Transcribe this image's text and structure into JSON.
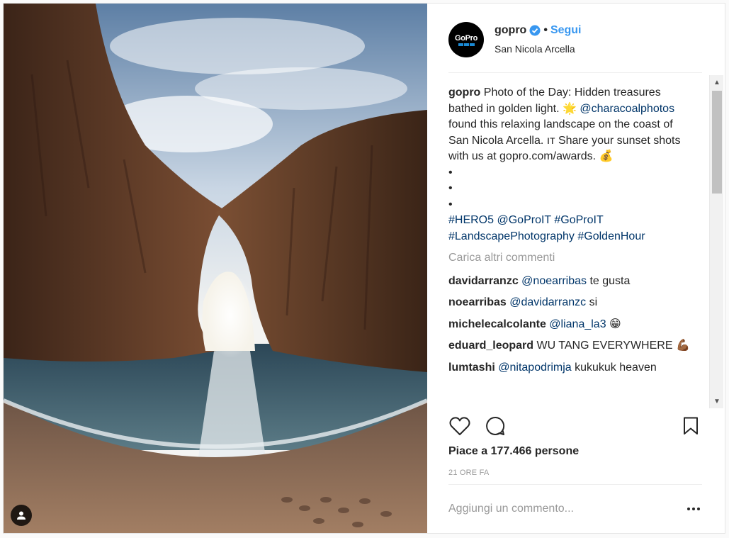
{
  "post": {
    "username": "gopro",
    "follow_label": "Segui",
    "separator": "•",
    "location": "San Nicola Arcella",
    "avatar_logo_text": "GoPro"
  },
  "caption": {
    "username": "gopro",
    "text_1": "Photo of the Day: Hidden treasures bathed in golden light.",
    "emoji_1": "🌟",
    "mention": "@characoalphotos",
    "text_2": "found this relaxing landscape on the coast of San Nicola Arcella. ıт Share your sunset shots with us at gopro.com/awards.",
    "emoji_2": "💰",
    "bullets": [
      "•",
      "•",
      "•"
    ],
    "tags_line": [
      "#HERO5",
      "@GoProIT",
      "#GoProIT"
    ],
    "tags_line2": [
      "#LandscapePhotography",
      "#GoldenHour"
    ]
  },
  "load_more_label": "Carica altri commenti",
  "comments": [
    {
      "user": "davidarranzc",
      "mention": "@noearribas",
      "text": "te gusta"
    },
    {
      "user": "noearribas",
      "mention": "@davidarranzc",
      "text": "si"
    },
    {
      "user": "michelecalcolante",
      "mention": "@liana_la3",
      "text": "😁"
    },
    {
      "user": "eduard_leopard",
      "mention": "",
      "text": "WU TANG EVERYWHERE 💪🏾"
    },
    {
      "user": "lumtashi",
      "mention": "@nitapodrimja",
      "text": "kukukuk heaven"
    }
  ],
  "likes_label": "Piace a 177.466 persone",
  "time_label": "21 ORE FA",
  "add_comment_placeholder": "Aggiungi un commento...",
  "icons": {
    "tag": "user-tag-icon",
    "like": "heart-icon",
    "comment": "comment-bubble-icon",
    "save": "bookmark-icon",
    "verified": "verified-badge-icon",
    "more": "more-options-icon"
  },
  "colors": {
    "link": "#3897f0",
    "mention": "#003569",
    "muted": "#999999",
    "verified": "#3897f0"
  }
}
